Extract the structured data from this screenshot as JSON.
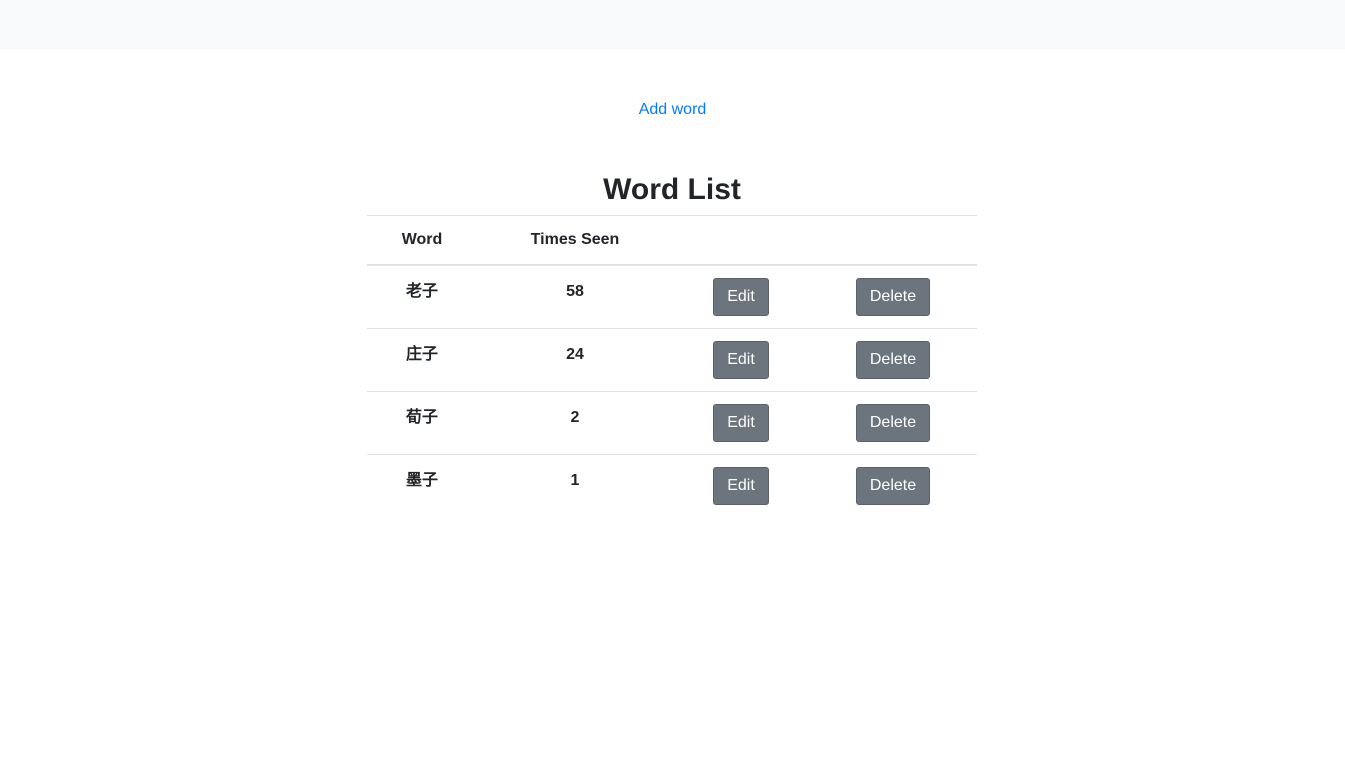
{
  "nav": {
    "add_word_label": "Add word"
  },
  "page": {
    "title": "Word List"
  },
  "table": {
    "headers": [
      "Word",
      "Times Seen"
    ],
    "rows": [
      {
        "word": "老子",
        "times_seen": "58",
        "edit_label": "Edit",
        "delete_label": "Delete"
      },
      {
        "word": "庄子",
        "times_seen": "24",
        "edit_label": "Edit",
        "delete_label": "Delete"
      },
      {
        "word": "荀子",
        "times_seen": "2",
        "edit_label": "Edit",
        "delete_label": "Delete"
      },
      {
        "word": "墨子",
        "times_seen": "1",
        "edit_label": "Edit",
        "delete_label": "Delete"
      }
    ]
  },
  "colors": {
    "link": "#007bff",
    "button_secondary": "#6c757d",
    "topbar": "#f8f9fa"
  }
}
